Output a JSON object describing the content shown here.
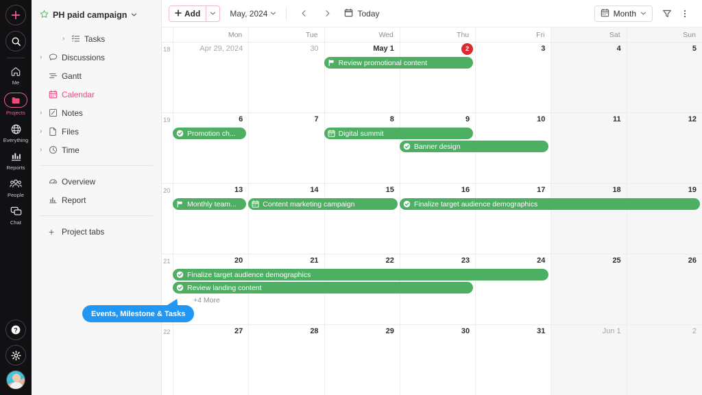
{
  "rail": {
    "add_icon": "plus-icon",
    "search_icon": "search-icon",
    "items": [
      {
        "label": "Me",
        "icon": "home-icon",
        "active": false
      },
      {
        "label": "Projects",
        "icon": "folder-icon",
        "active": true
      },
      {
        "label": "Everything",
        "icon": "globe-icon",
        "active": false
      },
      {
        "label": "Reports",
        "icon": "chart-icon",
        "active": false
      },
      {
        "label": "People",
        "icon": "people-icon",
        "active": false
      },
      {
        "label": "Chat",
        "icon": "chat-icon",
        "active": false
      }
    ],
    "bottom": [
      {
        "name": "help-icon"
      },
      {
        "name": "settings-icon"
      },
      {
        "name": "user-avatar"
      }
    ]
  },
  "sidebar": {
    "project_title": "PH paid campaign",
    "star_icon": "star-icon",
    "chevron_icon": "chevron-down-icon",
    "items": [
      {
        "label": "Tasks",
        "icon": "tasks-icon",
        "expandable": true,
        "indent": true,
        "active": false
      },
      {
        "label": "Discussions",
        "icon": "discussion-icon",
        "expandable": true,
        "indent": false,
        "active": false
      },
      {
        "label": "Gantt",
        "icon": "gantt-icon",
        "expandable": false,
        "indent": false,
        "active": false
      },
      {
        "label": "Calendar",
        "icon": "calendar-icon",
        "expandable": false,
        "indent": false,
        "active": true
      },
      {
        "label": "Notes",
        "icon": "notes-icon",
        "expandable": true,
        "indent": false,
        "active": false
      },
      {
        "label": "Files",
        "icon": "files-icon",
        "expandable": true,
        "indent": false,
        "active": false
      },
      {
        "label": "Time",
        "icon": "clock-icon",
        "expandable": true,
        "indent": false,
        "active": false
      }
    ],
    "secondary": [
      {
        "label": "Overview",
        "icon": "overview-icon"
      },
      {
        "label": "Report",
        "icon": "report-icon"
      }
    ],
    "project_tabs_label": "Project tabs",
    "project_tabs_icon": "plus-icon"
  },
  "toolbar": {
    "add_label": "Add",
    "add_icon": "plus-icon",
    "add_dropdown_icon": "chevron-down-icon",
    "month_label": "May, 2024",
    "month_dropdown_icon": "chevron-down-icon",
    "prev_icon": "chevron-left-icon",
    "next_icon": "chevron-right-icon",
    "today_label": "Today",
    "today_icon": "calendar-icon",
    "view_label": "Month",
    "view_icon": "calendar-icon",
    "view_dropdown_icon": "chevron-down-icon",
    "filter_icon": "filter-icon",
    "menu_icon": "more-vertical-icon"
  },
  "calendar": {
    "day_headers": [
      "Mon",
      "Tue",
      "Wed",
      "Thu",
      "Fri",
      "Sat",
      "Sun"
    ],
    "weeks": [
      {
        "week_number": "18",
        "days": [
          {
            "label": "Apr 29, 2024",
            "muted": true,
            "weekend": false
          },
          {
            "label": "30",
            "muted": true,
            "weekend": false
          },
          {
            "label": "May 1",
            "muted": false,
            "weekend": false
          },
          {
            "label": "2",
            "muted": false,
            "weekend": false,
            "badge": "2"
          },
          {
            "label": "3",
            "muted": false,
            "weekend": false
          },
          {
            "label": "4",
            "muted": false,
            "weekend": true
          },
          {
            "label": "5",
            "muted": false,
            "weekend": true
          }
        ],
        "events": [
          {
            "title": "Review promotional content",
            "icon": "flag-icon",
            "start": 2,
            "span": 2,
            "row": 0
          }
        ],
        "more": null
      },
      {
        "week_number": "19",
        "days": [
          {
            "label": "6",
            "muted": false,
            "weekend": false
          },
          {
            "label": "7",
            "muted": false,
            "weekend": false
          },
          {
            "label": "8",
            "muted": false,
            "weekend": false
          },
          {
            "label": "9",
            "muted": false,
            "weekend": false
          },
          {
            "label": "10",
            "muted": false,
            "weekend": false
          },
          {
            "label": "11",
            "muted": false,
            "weekend": true
          },
          {
            "label": "12",
            "muted": false,
            "weekend": true
          }
        ],
        "events": [
          {
            "title": "Promotion ch...",
            "icon": "check-icon",
            "start": 0,
            "span": 1,
            "row": 0
          },
          {
            "title": "Digital summit",
            "icon": "calendar-icon",
            "start": 2,
            "span": 2,
            "row": 0
          },
          {
            "title": "Banner design",
            "icon": "check-icon",
            "start": 3,
            "span": 2,
            "row": 1
          }
        ],
        "more": null
      },
      {
        "week_number": "20",
        "days": [
          {
            "label": "13",
            "muted": false,
            "weekend": false
          },
          {
            "label": "14",
            "muted": false,
            "weekend": false
          },
          {
            "label": "15",
            "muted": false,
            "weekend": false
          },
          {
            "label": "16",
            "muted": false,
            "weekend": false
          },
          {
            "label": "17",
            "muted": false,
            "weekend": false
          },
          {
            "label": "18",
            "muted": false,
            "weekend": true
          },
          {
            "label": "19",
            "muted": false,
            "weekend": true
          }
        ],
        "events": [
          {
            "title": "Monthly team...",
            "icon": "flag-icon",
            "start": 0,
            "span": 1,
            "row": 0
          },
          {
            "title": "Content marketing campaign",
            "icon": "calendar-icon",
            "start": 1,
            "span": 2,
            "row": 0
          },
          {
            "title": "Finalize target audience demographics",
            "icon": "check-icon",
            "start": 3,
            "span": 4,
            "row": 0
          }
        ],
        "more": null
      },
      {
        "week_number": "21",
        "days": [
          {
            "label": "20",
            "muted": false,
            "weekend": false
          },
          {
            "label": "21",
            "muted": false,
            "weekend": false
          },
          {
            "label": "22",
            "muted": false,
            "weekend": false
          },
          {
            "label": "23",
            "muted": false,
            "weekend": false
          },
          {
            "label": "24",
            "muted": false,
            "weekend": false
          },
          {
            "label": "25",
            "muted": false,
            "weekend": true
          },
          {
            "label": "26",
            "muted": false,
            "weekend": true
          }
        ],
        "events": [
          {
            "title": "Finalize target audience demographics",
            "icon": "check-icon",
            "start": 0,
            "span": 5,
            "row": 0
          },
          {
            "title": "Review landing content",
            "icon": "check-icon",
            "start": 0,
            "span": 4,
            "row": 1
          }
        ],
        "more": {
          "label": "+4 More",
          "start": 0,
          "row": 2
        }
      },
      {
        "week_number": "22",
        "days": [
          {
            "label": "27",
            "muted": false,
            "weekend": false
          },
          {
            "label": "28",
            "muted": false,
            "weekend": false
          },
          {
            "label": "29",
            "muted": false,
            "weekend": false
          },
          {
            "label": "30",
            "muted": false,
            "weekend": false
          },
          {
            "label": "31",
            "muted": false,
            "weekend": false
          },
          {
            "label": "Jun 1",
            "muted": true,
            "weekend": true
          },
          {
            "label": "2",
            "muted": true,
            "weekend": true
          }
        ],
        "events": [],
        "more": null
      }
    ]
  },
  "tooltip": {
    "text": "Events, Milestone & Tasks",
    "color": "#2196f3"
  },
  "colors": {
    "event_green": "#4caf62",
    "badge_red": "#e0282e",
    "accent_pink": "#ec4b7c",
    "weekend_bg": "#f6f6f7"
  }
}
